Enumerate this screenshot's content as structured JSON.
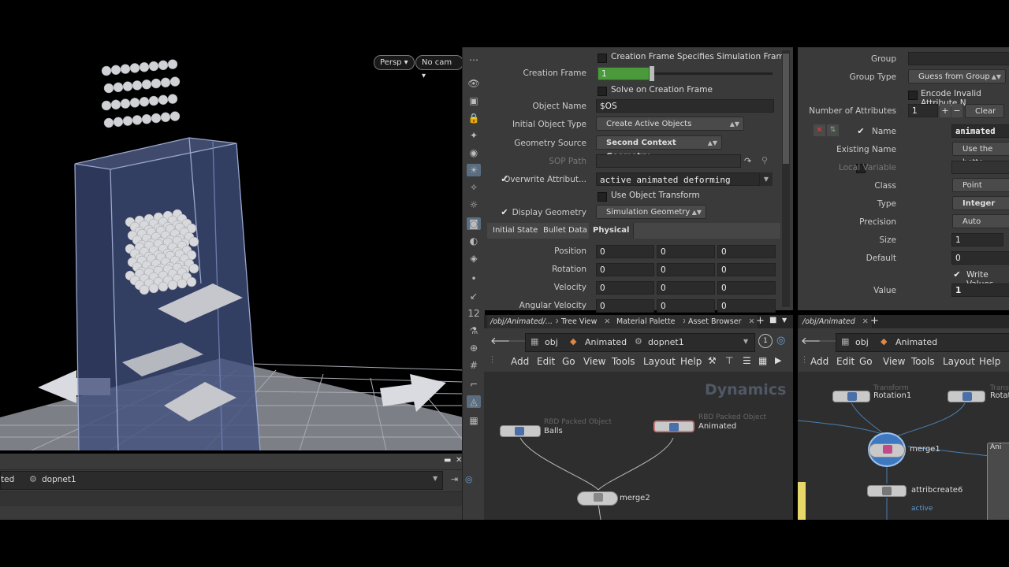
{
  "viewport": {
    "persp_label": "Persp ▾",
    "cam_label": "No cam ▾",
    "path_root_partial": "ted",
    "path_node": "dopnet1"
  },
  "params": {
    "creation_frame_specifies": "Creation Frame Specifies Simulation Frame",
    "creation_frame_label": "Creation Frame",
    "creation_frame_value": "1",
    "solve_on_creation_frame": "Solve on Creation Frame",
    "object_name_label": "Object Name",
    "object_name_value": "$OS",
    "initial_object_type_label": "Initial Object Type",
    "initial_object_type_value": "Create Active Objects",
    "geometry_source_label": "Geometry Source",
    "geometry_source_value": "Second Context Geometry",
    "sop_path_label": "SOP Path",
    "overwrite_label": "Overwrite Attribut...",
    "overwrite_value": "active animated deforming",
    "use_object_transform": "Use Object Transform",
    "display_geometry_label": "Display Geometry",
    "display_geometry_value": "Simulation Geometry",
    "tabs": [
      "Initial State",
      "Bullet Data",
      "Physical"
    ],
    "vectors": [
      {
        "label": "Position",
        "x": "0",
        "y": "0",
        "z": "0"
      },
      {
        "label": "Rotation",
        "x": "0",
        "y": "0",
        "z": "0"
      },
      {
        "label": "Velocity",
        "x": "0",
        "y": "0",
        "z": "0"
      },
      {
        "label": "Angular Velocity",
        "x": "0",
        "y": "0",
        "z": "0"
      }
    ]
  },
  "attrib": {
    "group_label": "Group",
    "group_type_label": "Group Type",
    "group_type_value": "Guess from Group",
    "encode_invalid": "Encode Invalid Attribute N",
    "num_attribs_label": "Number of Attributes",
    "num_attribs_value": "1",
    "clear_label": "Clear",
    "name_label": "Name",
    "name_value": "animated",
    "existing_name_label": "Existing Name",
    "existing_name_value": "Use the bette",
    "local_variable_label": "Local Variable",
    "class_label": "Class",
    "class_value": "Point",
    "type_label": "Type",
    "type_value": "Integer",
    "precision_label": "Precision",
    "precision_value": "Auto",
    "size_label": "Size",
    "size_value": "1",
    "default_label": "Default",
    "default_value": "0",
    "write_values": "Write Values",
    "value_label": "Value",
    "value_value": "1"
  },
  "net1": {
    "tabs": [
      "/obj/Animated/...",
      "Tree View",
      "Material Palette",
      "Asset Browser"
    ],
    "crumb_obj": "obj",
    "crumb_animated": "Animated",
    "crumb_dopnet": "dopnet1",
    "badge": "1",
    "menus": [
      "Add",
      "Edit",
      "Go",
      "View",
      "Tools",
      "Layout",
      "Help"
    ],
    "context_label": "Dynamics",
    "nodes": {
      "balls_type": "RBD Packed Object",
      "balls_name": "Balls",
      "animated_type": "RBD Packed Object",
      "animated_name": "Animated",
      "merge_name": "merge2"
    }
  },
  "net2": {
    "tab": "/obj/Animated",
    "crumb_obj": "obj",
    "crumb_animated": "Animated",
    "menus": [
      "Add",
      "Edit",
      "Go",
      "View",
      "Tools",
      "Layout",
      "Help"
    ],
    "nodes": {
      "rot1_type": "Transform",
      "rot1_name": "Rotation1",
      "rot2_type": "Transf",
      "rot2_name": "Rotat",
      "merge_name": "merge1",
      "attrib_name": "attribcreate6",
      "attrib_sub": "active",
      "box_label": "Ani"
    }
  }
}
